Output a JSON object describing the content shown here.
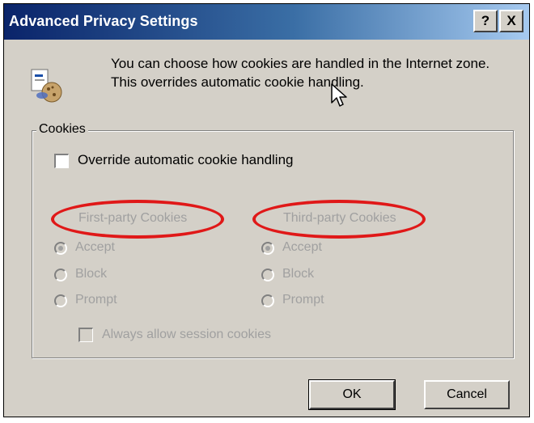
{
  "window": {
    "title": "Advanced Privacy Settings",
    "help_glyph": "?",
    "close_glyph": "X"
  },
  "intro": {
    "text": "You can choose how cookies are handled in the Internet zone.  This overrides automatic cookie handling.",
    "icon": "privacy-cookie-icon"
  },
  "cookies_group": {
    "label": "Cookies",
    "override_label": "Override automatic cookie handling",
    "override_checked": false,
    "first_party": {
      "heading": "First-party Cookies",
      "options": [
        "Accept",
        "Block",
        "Prompt"
      ],
      "selected": "Accept"
    },
    "third_party": {
      "heading": "Third-party Cookies",
      "options": [
        "Accept",
        "Block",
        "Prompt"
      ],
      "selected": "Accept"
    },
    "session_label": "Always allow session cookies",
    "session_checked": false
  },
  "buttons": {
    "ok": "OK",
    "cancel": "Cancel"
  },
  "colors": {
    "highlight_ellipse": "#e01818",
    "title_bar": "#0a246a",
    "dialog_face": "#d4d0c8",
    "disabled_text": "#a0a0a0"
  }
}
